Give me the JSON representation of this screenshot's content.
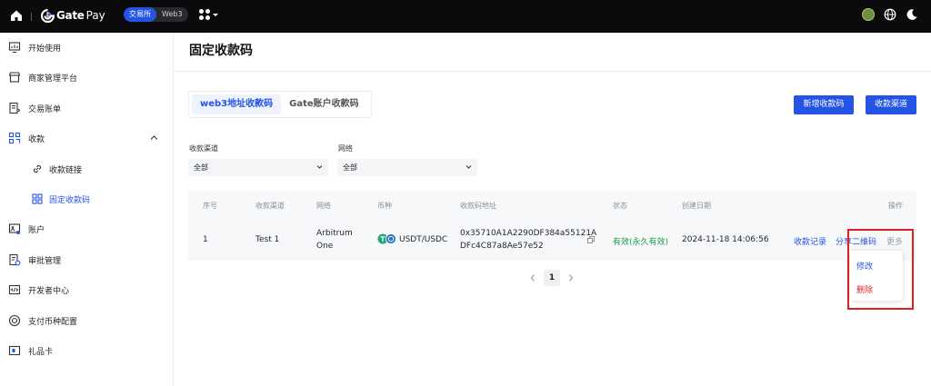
{
  "topbar": {
    "logo_gate": "Gate",
    "logo_pay": "Pay",
    "switch": [
      "交易所",
      "Web3"
    ]
  },
  "sidebar": {
    "items": [
      {
        "label": "开始使用",
        "icon": "chart-board-icon"
      },
      {
        "label": "商家管理平台",
        "icon": "store-icon"
      },
      {
        "label": "交易账单",
        "icon": "bill-icon"
      },
      {
        "label": "收款",
        "icon": "qr-grid-icon"
      },
      {
        "label": "收款链接",
        "icon": "link-icon"
      },
      {
        "label": "固定收款码",
        "icon": "qr-code-icon"
      },
      {
        "label": "账户",
        "icon": "account-icon"
      },
      {
        "label": "审批管理",
        "icon": "approval-icon"
      },
      {
        "label": "开发者中心",
        "icon": "code-icon"
      },
      {
        "label": "支付币种配置",
        "icon": "coin-config-icon"
      },
      {
        "label": "礼品卡",
        "icon": "gift-card-icon"
      }
    ]
  },
  "page": {
    "title": "固定收款码",
    "tabs": [
      "web3地址收款码",
      "Gate账户收款码"
    ],
    "btn_new": "新增收款码",
    "btn_channel": "收款渠道"
  },
  "filters": {
    "channel_label": "收款渠道",
    "channel_value": "全部",
    "network_label": "网络",
    "network_value": "全部"
  },
  "table": {
    "headers": [
      "序号",
      "收款渠道",
      "网络",
      "币种",
      "收款码地址",
      "状态",
      "创建日期",
      "操作"
    ],
    "rows": [
      {
        "index": "1",
        "channel": "Test 1",
        "network_line1": "Arbitrum",
        "network_line2": "One",
        "coin": "USDT/USDC",
        "address_line1": "0x35710A1A2290DF384a55121A",
        "address_line2": "DFc4C87a8Ae57e52",
        "status": "有效(永久有效)",
        "created": "2024-11-18 14:06:56",
        "action_records": "收款记录",
        "action_share": "分享二维码",
        "action_more": "更多"
      }
    ]
  },
  "pagination": {
    "current": "1"
  },
  "more_menu": {
    "edit": "修改",
    "delete": "删除"
  }
}
